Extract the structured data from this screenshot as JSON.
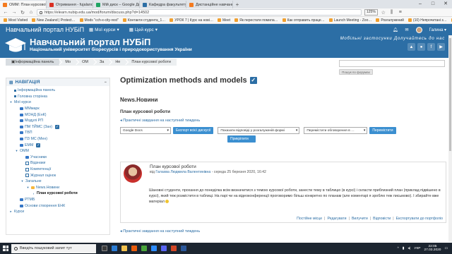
{
  "browser": {
    "tabs": [
      {
        "label": "ОММ: План курсової робот",
        "color": "#f47b20",
        "active": true
      },
      {
        "label": "Отримання - fujalanca@…",
        "color": "#d93025"
      },
      {
        "label": "Мій диск – Google Диск",
        "color": "#1fa463"
      },
      {
        "label": "Кафедра факультету",
        "color": "#2c6ea5"
      },
      {
        "label": "Дистанційне навчання на к",
        "color": "#f47b20"
      }
    ],
    "url": "https://elearn.nubip.edu.ua/mod/forum/discuss.php?d=14502",
    "zoom": "125%",
    "bookmarks": [
      "Most Visited",
      "New Zealand | Protect…",
      "Mods \"cch-x-city-rest\"",
      "Контакти студента_1…",
      "УРОК 7 | Курс на нові…",
      "Meet",
      "Як перестати помила…",
      "Как отправить праце…",
      "Launch Meeting - Zoo…",
      "Розгалужений",
      "(10) Непрочитані з…",
      "Активність студента …"
    ]
  },
  "navbar": {
    "site_name": "Навчальний портал НУБіП",
    "my_courses": "Мої курси",
    "this_course": "Цей курс",
    "user_name": "Галина"
  },
  "banner": {
    "title": "Навчальний портал НУБіП",
    "subtitle": "Національний університет біоресурсів і природокористування України",
    "slogan": "Мобільні застосунки   Долучайтесь до нас"
  },
  "search": {
    "button": "Пошук по форумах"
  },
  "breadcrumb": [
    "Інформаційна панель",
    "Мо",
    "ОМ",
    "За",
    "Не",
    "План курсової роботи"
  ],
  "sidebar": {
    "heading": "НАВІГАЦІЯ",
    "items": [
      {
        "label": "Інформаційна панель",
        "indent": 0,
        "type": "link"
      },
      {
        "label": "Головна сторінка",
        "indent": 0,
        "type": "link"
      },
      {
        "label": "Мої курси",
        "indent": 0,
        "type": "open"
      },
      {
        "label": "ММмарк",
        "indent": 1,
        "type": "course"
      },
      {
        "label": "МОНД (ЕнК)",
        "indent": 1,
        "type": "course"
      },
      {
        "label": "Модулі РП",
        "indent": 1,
        "type": "course"
      },
      {
        "label": "ПМ ТЙМС (Зан)",
        "indent": 1,
        "type": "course",
        "checked": true
      },
      {
        "label": "ТВП",
        "indent": 1,
        "type": "course"
      },
      {
        "label": "ПЗ МС (Мен)",
        "indent": 1,
        "type": "course"
      },
      {
        "label": "ЕММ",
        "indent": 1,
        "type": "course",
        "checked": true
      },
      {
        "label": "ОММ",
        "indent": 1,
        "type": "open"
      },
      {
        "label": "Учасники",
        "indent": 2,
        "type": "folder"
      },
      {
        "label": "Відзнаки",
        "indent": 2,
        "type": "icon"
      },
      {
        "label": "Компетенції",
        "indent": 2,
        "type": "icon"
      },
      {
        "label": "Журнал оцінок",
        "indent": 2,
        "type": "icon"
      },
      {
        "label": "Загальне",
        "indent": 2,
        "type": "open"
      },
      {
        "label": "News.Новини",
        "indent": 3,
        "type": "openfolder"
      },
      {
        "label": "План курсової роботи",
        "indent": 4,
        "type": "current"
      },
      {
        "label": "РТМБ",
        "indent": 1,
        "type": "course"
      },
      {
        "label": "Основи створення ЕНК",
        "indent": 1,
        "type": "course"
      },
      {
        "label": "Курси",
        "indent": 0,
        "type": "closed"
      }
    ]
  },
  "main": {
    "course_title": "Optimization methods and models",
    "forum_name": "News.Новини",
    "discussion_title": "План курсової роботи",
    "next_link": "Практичні завдання на наступний тиждень",
    "controls": {
      "group_select": "Google Docs",
      "export_button": "Експорт всієї дискусії",
      "display_select": "Показати відповіді у розгалуженій формі",
      "move_select": "Перемістити обговорення в …",
      "move_button": "Перемістити",
      "pin_button": "Прикріпити"
    },
    "post": {
      "subject": "План курсової роботи",
      "by_prefix": "від",
      "author": "Галахва Людмила Валентинівна",
      "date": "- середа 25 березня 2020, 16:42",
      "body": "Шановні студенти, прохання до понеділка всім  визначитися з темою курсової роботи, занести тему в таблицю (в курсі) і скласти приблизний план (приклад підвішено в курсі), який теж розмістити в таблиці. На парі чи на відеоконференції проговоримо більш конкретно по планам (але коментарі я зроблю теж письмово). І збирайте вже матеріал",
      "actions": [
        "Постійне місце",
        "Редагувати",
        "Вилучити",
        "Відповісти",
        "Експортувати до портфоліо"
      ]
    }
  },
  "taskbar": {
    "search_placeholder": "Введіть пошуковий запит тут",
    "lang": "УКР",
    "time": "22:05",
    "date": "27.03.2020"
  }
}
